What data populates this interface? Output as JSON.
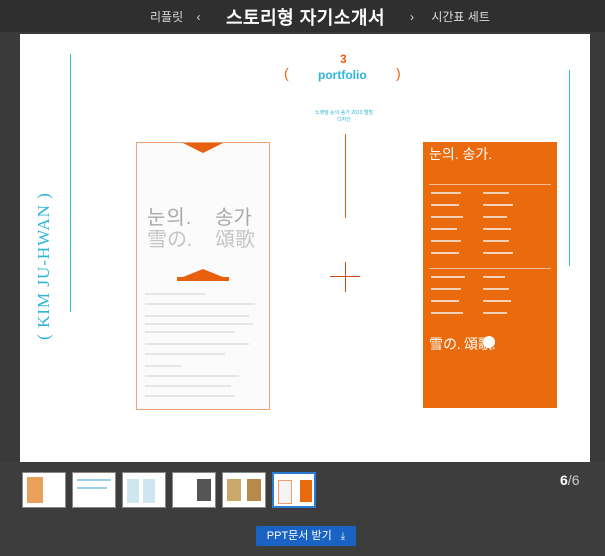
{
  "nav": {
    "prev_label": "리플릿",
    "prev_chevron": "‹",
    "title": "스토리형 자기소개서",
    "next_chevron": "›",
    "next_label": "시간표 세트"
  },
  "slide": {
    "name_vertical": "( KIM JU-HWAN )",
    "section_number": "3",
    "section_label": "portfolio",
    "paren_open": "(",
    "paren_close": ")",
    "subtitle": "노랫말 눈의 송가 2013 앨범디자인"
  },
  "poster_left": {
    "title_ko_a": "눈의.",
    "title_ko_b": "송가",
    "title_cn_a": "雪の.",
    "title_cn_b": "頌歌"
  },
  "poster_right": {
    "title_ko": "눈의. 송가.",
    "title_cn": "雪の. 頌歌."
  },
  "pager": {
    "current": "6",
    "separator": "/",
    "total": "6"
  },
  "download": {
    "label": "PPT문서 받기",
    "icon": "download-icon"
  },
  "colors": {
    "accent_orange": "#e8600f",
    "accent_cyan": "#2fb5d8",
    "button_blue": "#1a63c4"
  }
}
